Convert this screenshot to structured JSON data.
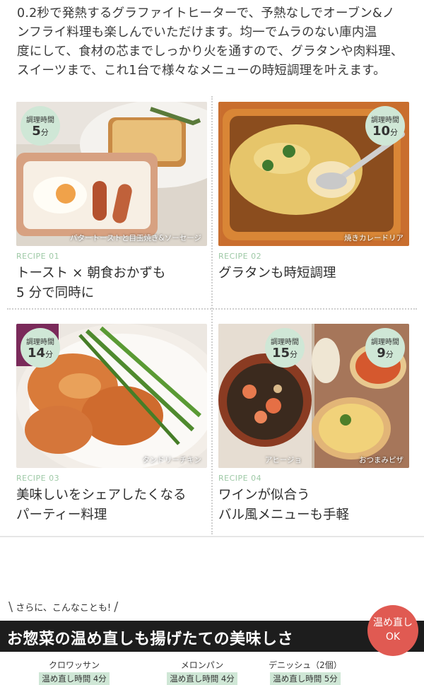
{
  "intro": {
    "line1": "0.2秒で発熱するグラファイトヒーターで、予熱なしでオーブン&ノ",
    "line2": "ンフライ料理も楽しんでいただけます。均一でムラのない庫内温",
    "line3": "度にして、食材の芯までしっかり火を通すので、グラタンや肉料理、",
    "line4": "スイーツまで、これ1台で様々なメニューの時短調理を叶えます。"
  },
  "recipes": [
    {
      "number": "RECIPE 01",
      "title_line1": "トースト × 朝食おかずも",
      "title_line2": "5 分で同時に",
      "caption": "バタートーストと目玉焼き&ソーセージ",
      "badge": {
        "label": "調理時間",
        "value": "5",
        "unit": "分"
      }
    },
    {
      "number": "RECIPE 02",
      "title_line1": "グラタンも時短調理",
      "title_line2": "",
      "caption": "焼きカレードリア",
      "badge": {
        "label": "調理時間",
        "value": "10",
        "unit": "分"
      }
    },
    {
      "number": "RECIPE 03",
      "title_line1": "美味しいをシェアしたくなる",
      "title_line2": "パーティー料理",
      "caption": "タンドリーチキン",
      "badge": {
        "label": "調理時間",
        "value": "14",
        "unit": "分"
      }
    },
    {
      "number": "RECIPE 04",
      "title_line1": "ワインが似合う",
      "title_line2": "バル風メニューも手軽",
      "caption": "アヒージョ",
      "caption2": "おつまみピザ",
      "badge": {
        "label": "調理時間",
        "value": "15",
        "unit": "分"
      },
      "badge2": {
        "label": "調理時間",
        "value": "9",
        "unit": "分"
      }
    }
  ],
  "more": {
    "text": "さらに、こんなことも!"
  },
  "banner": {
    "text": "お惣菜の温め直しも揚げたての美味しさ",
    "badge_line1": "温め直し",
    "badge_line2": "OK"
  },
  "reheat_items": [
    {
      "name": "クロワッサン",
      "time": "温め直し時間 4分"
    },
    {
      "name": "メロンパン",
      "time": "温め直し時間 4分"
    },
    {
      "name": "デニッシュ（2個）",
      "time": "温め直し時間 5分"
    }
  ],
  "colors": {
    "badge": "#cfe7d6",
    "recipe_number": "#9ec9a6",
    "banner_bg": "#1d1d1d",
    "banner_badge": "#e05a52"
  }
}
